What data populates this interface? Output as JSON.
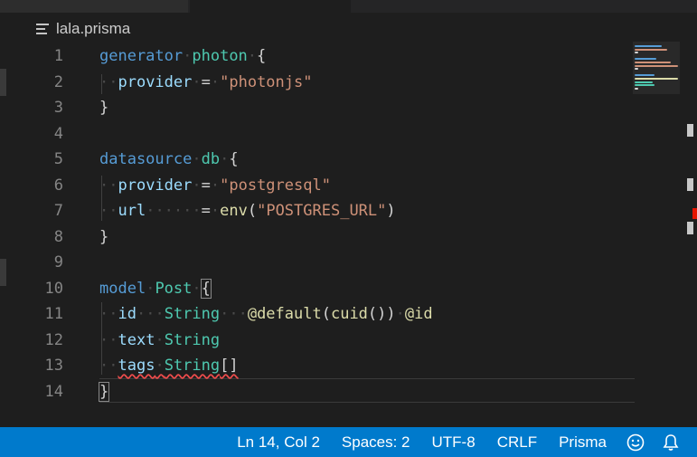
{
  "breadcrumb": {
    "icon": "file-lines-icon",
    "filename": "lala.prisma"
  },
  "editor": {
    "line_numbers": [
      "1",
      "2",
      "3",
      "4",
      "5",
      "6",
      "7",
      "8",
      "9",
      "10",
      "11",
      "12",
      "13",
      "14"
    ],
    "lines": [
      [
        {
          "t": "generator",
          "c": "kw"
        },
        {
          "t": "·",
          "c": "ws"
        },
        {
          "t": "photon",
          "c": "tp"
        },
        {
          "t": "·",
          "c": "ws"
        },
        {
          "t": "{",
          "c": "pn"
        }
      ],
      [
        {
          "t": "··",
          "c": "ws"
        },
        {
          "t": "provider",
          "c": "fld"
        },
        {
          "t": "·",
          "c": "ws"
        },
        {
          "t": "=",
          "c": "pn"
        },
        {
          "t": "·",
          "c": "ws"
        },
        {
          "t": "\"photonjs\"",
          "c": "str"
        }
      ],
      [
        {
          "t": "}",
          "c": "pn"
        }
      ],
      [],
      [
        {
          "t": "datasource",
          "c": "kw"
        },
        {
          "t": "·",
          "c": "ws"
        },
        {
          "t": "db",
          "c": "tp"
        },
        {
          "t": "·",
          "c": "ws"
        },
        {
          "t": "{",
          "c": "pn"
        }
      ],
      [
        {
          "t": "··",
          "c": "ws"
        },
        {
          "t": "provider",
          "c": "fld"
        },
        {
          "t": "·",
          "c": "ws"
        },
        {
          "t": "=",
          "c": "pn"
        },
        {
          "t": "·",
          "c": "ws"
        },
        {
          "t": "\"postgresql\"",
          "c": "str"
        }
      ],
      [
        {
          "t": "··",
          "c": "ws"
        },
        {
          "t": "url",
          "c": "fld"
        },
        {
          "t": "······",
          "c": "ws"
        },
        {
          "t": "=",
          "c": "pn"
        },
        {
          "t": "·",
          "c": "ws"
        },
        {
          "t": "env",
          "c": "fn"
        },
        {
          "t": "(",
          "c": "pn"
        },
        {
          "t": "\"POSTGRES_URL\"",
          "c": "str"
        },
        {
          "t": ")",
          "c": "pn"
        }
      ],
      [
        {
          "t": "}",
          "c": "pn"
        }
      ],
      [],
      [
        {
          "t": "model",
          "c": "kw"
        },
        {
          "t": "·",
          "c": "ws"
        },
        {
          "t": "Post",
          "c": "tp"
        },
        {
          "t": "·",
          "c": "ws"
        },
        {
          "t": "{",
          "c": "pn cursor-box"
        }
      ],
      [
        {
          "t": "··",
          "c": "ws"
        },
        {
          "t": "id",
          "c": "fld"
        },
        {
          "t": "···",
          "c": "ws"
        },
        {
          "t": "String",
          "c": "tp"
        },
        {
          "t": "···",
          "c": "ws"
        },
        {
          "t": "@default",
          "c": "fn"
        },
        {
          "t": "(",
          "c": "pn"
        },
        {
          "t": "cuid",
          "c": "fn"
        },
        {
          "t": "())",
          "c": "pn"
        },
        {
          "t": "·",
          "c": "ws"
        },
        {
          "t": "@id",
          "c": "fn"
        }
      ],
      [
        {
          "t": "··",
          "c": "ws"
        },
        {
          "t": "text",
          "c": "fld"
        },
        {
          "t": "·",
          "c": "ws"
        },
        {
          "t": "String",
          "c": "tp"
        }
      ],
      [
        {
          "t": "··",
          "c": "ws"
        },
        {
          "t": "tags",
          "c": "fld err"
        },
        {
          "t": "·",
          "c": "ws err"
        },
        {
          "t": "String",
          "c": "tp err"
        },
        {
          "t": "[]",
          "c": "pn err"
        }
      ],
      [
        {
          "t": "}",
          "c": "pn cursor-box"
        }
      ]
    ]
  },
  "minimap": {
    "lines": [
      {
        "w": 30,
        "c": "#569cd6"
      },
      {
        "w": 36,
        "c": "#ce9178"
      },
      {
        "w": 4,
        "c": "#d4d4d4"
      },
      {
        "w": 0,
        "c": "#000000"
      },
      {
        "w": 24,
        "c": "#569cd6"
      },
      {
        "w": 40,
        "c": "#ce9178"
      },
      {
        "w": 48,
        "c": "#ce9178"
      },
      {
        "w": 4,
        "c": "#d4d4d4"
      },
      {
        "w": 0,
        "c": "#000000"
      },
      {
        "w": 22,
        "c": "#569cd6"
      },
      {
        "w": 48,
        "c": "#dcdcaa"
      },
      {
        "w": 20,
        "c": "#4ec9b0"
      },
      {
        "w": 22,
        "c": "#4ec9b0"
      },
      {
        "w": 4,
        "c": "#d4d4d4"
      }
    ]
  },
  "statusbar": {
    "position": "Ln 14, Col 2",
    "spaces": "Spaces: 2",
    "encoding": "UTF-8",
    "eol": "CRLF",
    "language": "Prisma",
    "feedback_icon": "smiley-icon",
    "notifications_icon": "bell-icon"
  },
  "colors": {
    "keyword": "#569cd6",
    "type": "#4ec9b0",
    "field": "#9cdcfe",
    "string": "#ce9178",
    "function": "#dcdcaa",
    "statusbar": "#007acc",
    "error": "#f14c4c"
  }
}
